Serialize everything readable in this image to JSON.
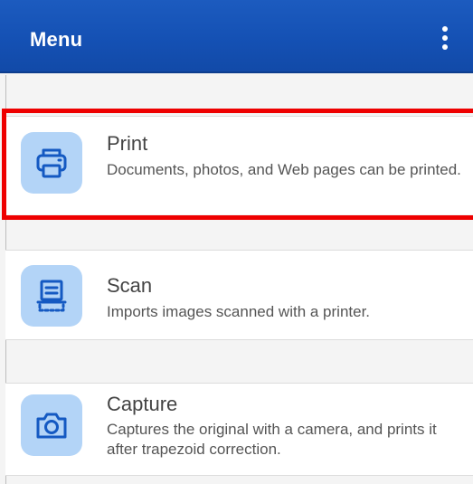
{
  "appbar": {
    "title": "Menu",
    "overflow_icon": "more-vert-icon",
    "color": "#1450b3"
  },
  "menu": {
    "items": [
      {
        "id": "print",
        "icon": "printer-icon",
        "title": "Print",
        "description": "Documents, photos, and Web pages can be printed."
      },
      {
        "id": "scan",
        "icon": "scanner-icon",
        "title": "Scan",
        "description": "Imports images scanned with a printer."
      },
      {
        "id": "capture",
        "icon": "camera-icon",
        "title": "Capture",
        "description": "Captures the original with a camera, and prints it after trapezoid correction."
      }
    ]
  },
  "colors": {
    "icon_tile": "#b3d4f7",
    "icon_stroke": "#1459c2",
    "highlight": "#ee0000"
  }
}
